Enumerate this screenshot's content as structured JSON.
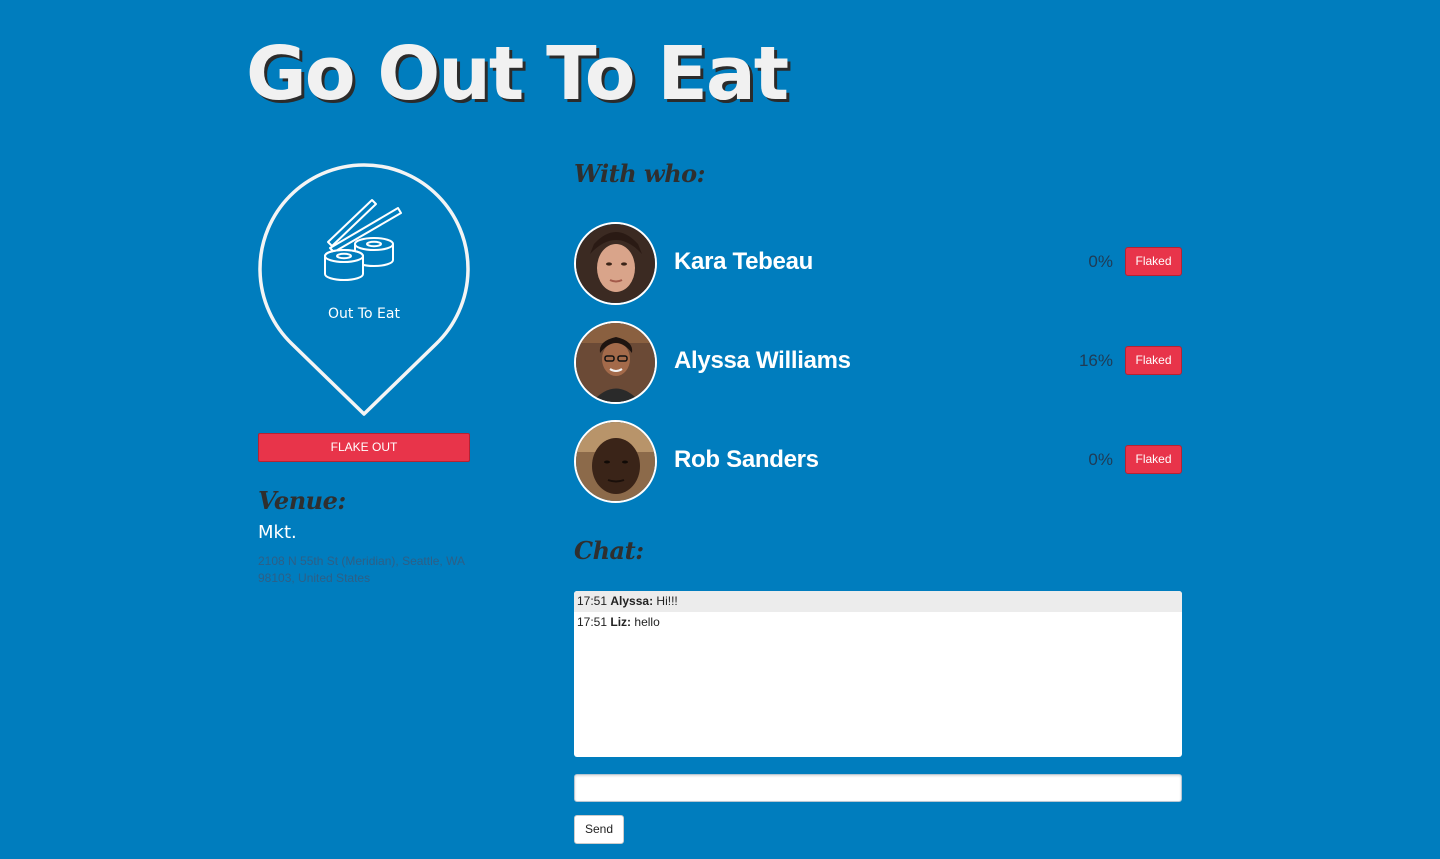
{
  "app": {
    "title": "Go Out To Eat",
    "accent_color": "#007dbe",
    "danger_color": "#e8344a"
  },
  "event": {
    "icon": "sushi-chopsticks-icon",
    "label": "Out To Eat",
    "flake_out_label": "FLAKE OUT"
  },
  "venue": {
    "heading": "Venue:",
    "name": "Mkt.",
    "address": "2108 N 55th St (Meridian), Seattle, WA 98103, United States"
  },
  "attendees": {
    "heading": "With who:",
    "people": [
      {
        "name": "Kara Tebeau",
        "flake_pct": "0%",
        "button_label": "Flaked"
      },
      {
        "name": "Alyssa Williams",
        "flake_pct": "16%",
        "button_label": "Flaked"
      },
      {
        "name": "Rob Sanders",
        "flake_pct": "0%",
        "button_label": "Flaked"
      }
    ]
  },
  "chat": {
    "heading": "Chat:",
    "messages": [
      {
        "time": "17:51",
        "author": "Alyssa:",
        "text": "Hi!!!"
      },
      {
        "time": "17:51",
        "author": "Liz:",
        "text": "hello"
      }
    ],
    "input_value": "",
    "send_label": "Send"
  }
}
